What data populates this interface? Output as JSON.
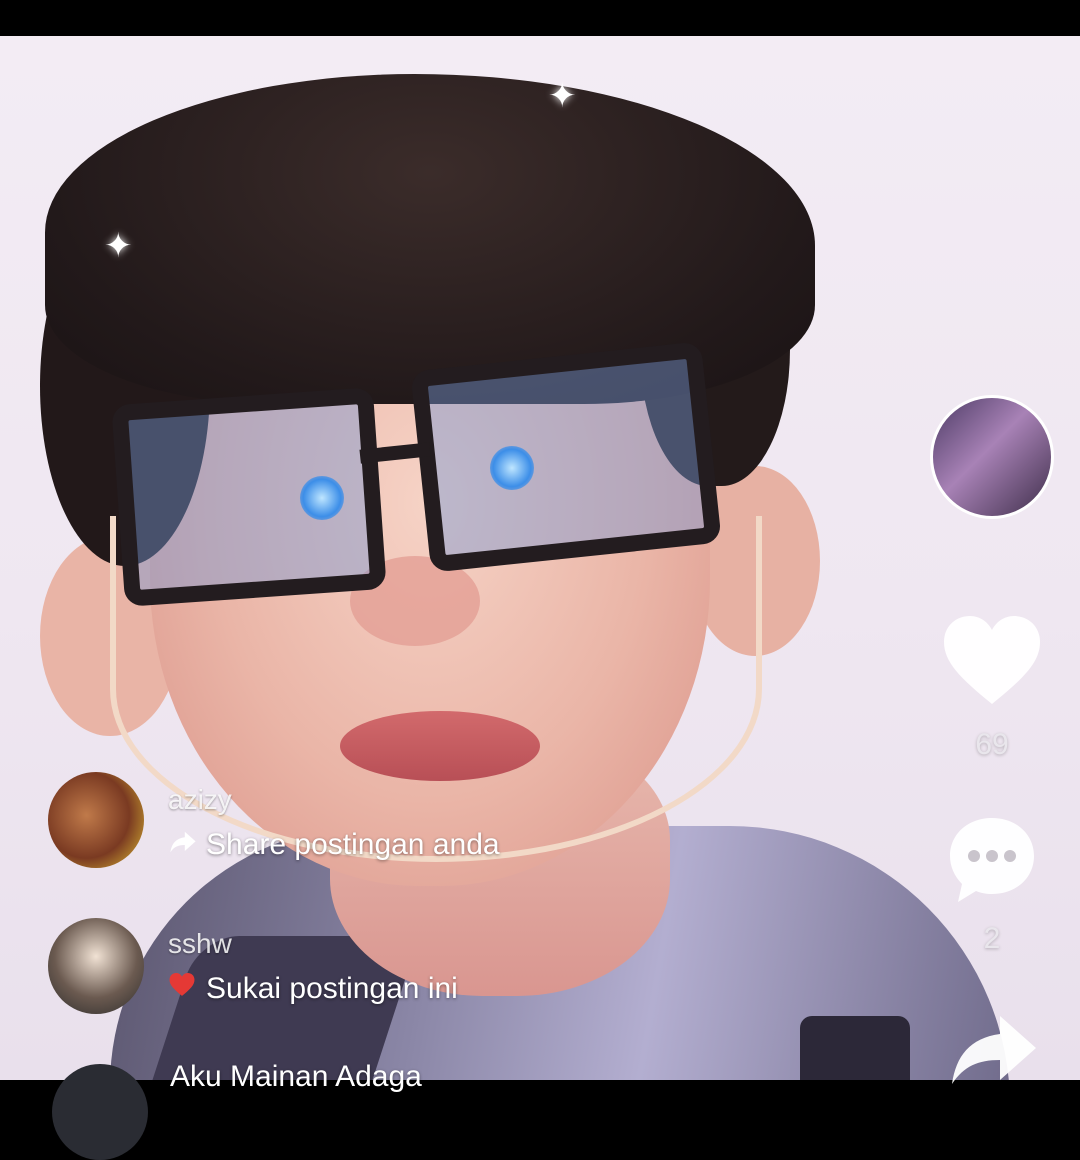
{
  "video": {
    "description_icons": [
      "sparkle-icon",
      "sparkle-icon"
    ]
  },
  "actions": {
    "music_disc_icon": "music-disc-icon",
    "like_icon": "heart-icon",
    "like_count": "69",
    "comment_icon": "comment-bubble-icon",
    "comment_count": "2",
    "share_icon": "share-arrow-icon"
  },
  "feed": [
    {
      "username": "azizy",
      "icon": "share-arrow-icon",
      "message": "Share postingan anda",
      "accent": "#ffffff"
    },
    {
      "username": "sshw",
      "icon": "heart-icon",
      "message": "Sukai postingan ini",
      "accent": "#e53935"
    },
    {
      "username": "",
      "icon": "",
      "message": "Aku Mainan Adaga"
    }
  ],
  "colors": {
    "background": "#efe7f1",
    "heart_red": "#e53935",
    "icon_white": "#ffffff"
  }
}
